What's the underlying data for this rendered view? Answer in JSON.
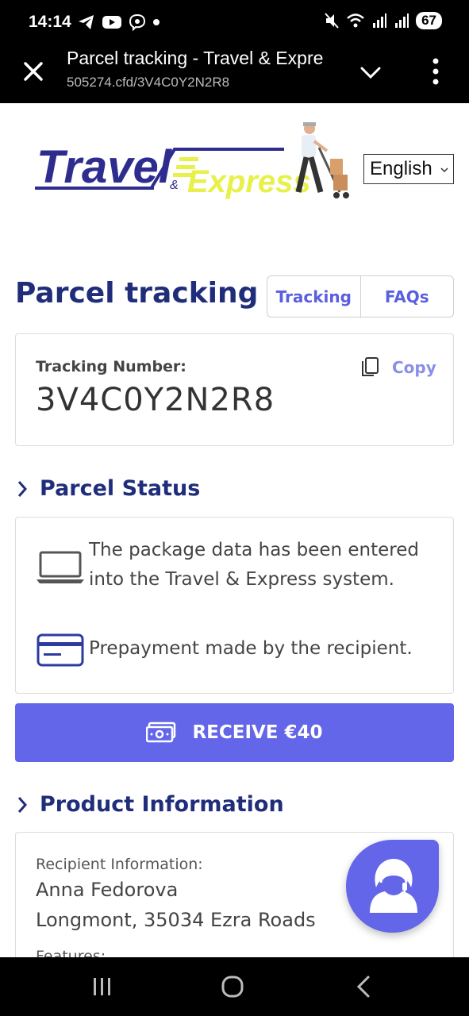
{
  "status_bar": {
    "time": "14:14",
    "battery": "67",
    "icons_left": [
      "telegram-icon",
      "youtube-icon",
      "viber-icon",
      "dot-icon"
    ],
    "icons_right": [
      "mute-icon",
      "wifi-icon",
      "signal-icon",
      "signal-icon",
      "battery-icon"
    ]
  },
  "browser": {
    "page_title": "Parcel tracking - Travel & Expre",
    "url": "505274.cfd/3V4C0Y2N2R8"
  },
  "header": {
    "logo_text_1": "Travel",
    "logo_amp": "&",
    "logo_text_2": "Express",
    "language": "English"
  },
  "main": {
    "title": "Parcel tracking",
    "tabs": [
      {
        "label": "Tracking"
      },
      {
        "label": "FAQs"
      }
    ],
    "tracking": {
      "label": "Tracking Number:",
      "number": "3V4C0Y2N2R8",
      "copy_label": "Copy"
    },
    "status_heading": "Parcel Status",
    "status_items": [
      {
        "icon": "laptop-icon",
        "text": "The package data has been entered into the Travel & Express system."
      },
      {
        "icon": "credit-card-icon",
        "text": "Prepayment made by the recipient."
      }
    ],
    "receive_button": "RECEIVE €40",
    "product_heading": "Product Information",
    "recipient_label": "Recipient Information:",
    "recipient_name": "Anna Fedorova",
    "recipient_address": "Longmont, 35034 Ezra Roads",
    "features_label": "Features:"
  },
  "colors": {
    "primary": "#6366e8",
    "heading": "#1f2d7a",
    "logo_yellow": "#e8f04a"
  }
}
